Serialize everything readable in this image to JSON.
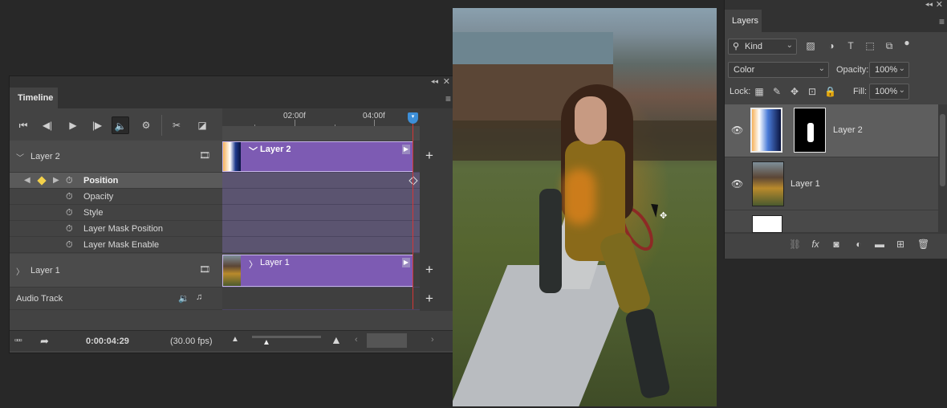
{
  "timeline": {
    "tab": "Timeline",
    "ruler": {
      "mark1": "02:00f",
      "mark2": "04:00f"
    },
    "layer2": {
      "name": "Layer 2",
      "clip_name": "Layer 2"
    },
    "properties": [
      "Position",
      "Opacity",
      "Style",
      "Layer Mask Position",
      "Layer Mask Enable"
    ],
    "layer1": {
      "name": "Layer 1",
      "clip_name": "Layer 1"
    },
    "audio_track": "Audio Track",
    "current_time": "0:00:04:29",
    "fps": "(30.00 fps)"
  },
  "layers": {
    "tab": "Layers",
    "filter_kind": "Kind",
    "blend_mode": "Color",
    "opacity_label": "Opacity:",
    "opacity_value": "100%",
    "lock_label": "Lock:",
    "fill_label": "Fill:",
    "fill_value": "100%",
    "items": [
      {
        "name": "Layer 2"
      },
      {
        "name": "Layer 1"
      }
    ]
  },
  "colors": {
    "clip_purple": "#7d5bb3",
    "playhead_red": "#d43636",
    "playhead_blue": "#3d8fd8",
    "keyframe_yellow": "#f3d14a"
  }
}
